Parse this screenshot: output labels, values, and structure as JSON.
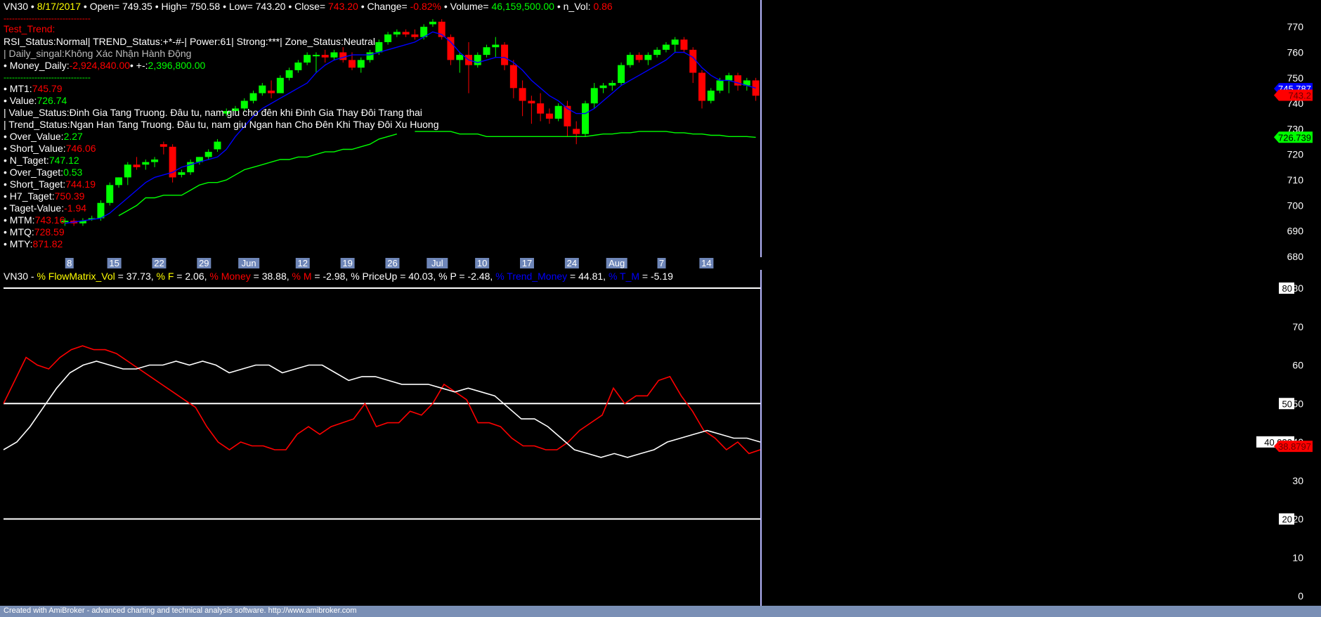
{
  "colors": {
    "bg": "#000000",
    "white": "#ffffff",
    "yellow": "#ffff00",
    "red": "#ff0000",
    "green": "#00ff00",
    "gray": "#bbbbbb",
    "blue": "#0000ff",
    "cursor": "#b8b8ff",
    "footer_bg": "#7a8fb5",
    "axis_badge": "#6e86b8"
  },
  "info": {
    "symbol": "VN30",
    "date": "8/17/2017",
    "open_label": "• Open=",
    "open": "749.35",
    "high_label": "• High=",
    "high": "750.58",
    "low_label": "• Low=",
    "low": "743.20",
    "close_label": "• Close=",
    "close": "743.20",
    "change_label": "• Change=",
    "change": "-0.82%",
    "volume_label": "• Volume=",
    "volume": "46,159,500.00",
    "nvol_label": "• n_Vol:",
    "nvol": "0.86",
    "dashes": "-------------------------------",
    "test_trend": "Test_Trend:",
    "status_line": "RSI_Status:Normal| TREND_Status:+*-#-| Power:61| Strong:***| Zone_Status:Neutral",
    "daily_signal": "| Daily_singal:Không Xác Nhận Hành Động",
    "money_label": "• Money_Daily:",
    "money_value": "-2,924,840.00",
    "money_sep": "• +-:",
    "money_plus": "2,396,800.00",
    "rows": [
      {
        "label": "• MT1:",
        "value": "745.79",
        "color": "#ff0000"
      },
      {
        "label": "• Value:",
        "value": "726.74",
        "color": "#00ff00"
      },
      {
        "label": "| Value_Status:Đinh Gia Tang Truong. Đâu tu, nam giu cho đên khi Đinh Gia Thay Đôi Trang thai",
        "value": "",
        "color": "#ffffff"
      },
      {
        "label": "| Trend_Status:Ngan Han Tang Truong. Đâu tu, nam giu Ngan han Cho Đên Khi Thay Đôi Xu Huong",
        "value": "",
        "color": "#ffffff"
      },
      {
        "label": "• Over_Value:",
        "value": "2.27",
        "color": "#00ff00"
      },
      {
        "label": "• Short_Value:",
        "value": "746.06",
        "color": "#ff0000"
      },
      {
        "label": "• N_Taget:",
        "value": "747.12",
        "color": "#00ff00"
      },
      {
        "label": "• Over_Taget:",
        "value": "0.53",
        "color": "#00ff00"
      },
      {
        "label": "• Short_Taget:",
        "value": "744.19",
        "color": "#ff0000"
      },
      {
        "label": "• H7_Taget:",
        "value": "750.39",
        "color": "#ff0000"
      },
      {
        "label": "• Taget-Value:",
        "value": "-1.94",
        "color": "#ff0000"
      },
      {
        "label": "• MTM:",
        "value": "743.16",
        "color": "#ff0000"
      },
      {
        "label": "• MTQ:",
        "value": "728.59",
        "color": "#ff0000"
      },
      {
        "label": "• MTY:",
        "value": "871.82",
        "color": "#ff0000"
      }
    ]
  },
  "date_axis": {
    "labels": [
      "8",
      "15",
      "22",
      "29",
      "Jun",
      "12",
      "19",
      "26",
      "Jul",
      "10",
      "17",
      "24",
      "Aug",
      "7",
      "14"
    ]
  },
  "price_axis": {
    "ticks": [
      "770",
      "760",
      "750",
      "740",
      "730",
      "720",
      "710",
      "700",
      "690",
      "680"
    ]
  },
  "price_badges": [
    {
      "text": "745.787",
      "value": 745.787,
      "fg": "#ffffff",
      "bg": "#0000ff"
    },
    {
      "text": "743.2",
      "value": 743.2,
      "fg": "#ff0000",
      "bg": "#ff0000"
    },
    {
      "text": "726.739",
      "value": 726.739,
      "fg": "#000000",
      "bg": "#00ff00"
    }
  ],
  "indicator": {
    "title_prefix": "VN30 - ",
    "parts": [
      {
        "text": "% FlowMatrix_Vol",
        "color": "#ffff00"
      },
      {
        "text": " = 37.73, ",
        "color": "#ffffff"
      },
      {
        "text": "% F",
        "color": "#ffff00"
      },
      {
        "text": " = 2.06, ",
        "color": "#ffffff"
      },
      {
        "text": "% Money",
        "color": "#ff0000"
      },
      {
        "text": " = 38.88, ",
        "color": "#ffffff"
      },
      {
        "text": "% M",
        "color": "#ff0000"
      },
      {
        "text": " = -2.98, ",
        "color": "#ffffff"
      },
      {
        "text": "% PriceUp",
        "color": "#ffffff"
      },
      {
        "text": " = 40.03, ",
        "color": "#ffffff"
      },
      {
        "text": "% P",
        "color": "#ffffff"
      },
      {
        "text": " = -2.48, ",
        "color": "#ffffff"
      },
      {
        "text": "% Trend_Money",
        "color": "#0000ff"
      },
      {
        "text": " = 44.81, ",
        "color": "#ffffff"
      },
      {
        "text": "% T_M",
        "color": "#0000ff"
      },
      {
        "text": " = -5.19",
        "color": "#ffffff"
      }
    ],
    "ticks": [
      "80",
      "70",
      "60",
      "50",
      "40",
      "30",
      "20",
      "10",
      "0"
    ],
    "badges": [
      {
        "text": "80",
        "value": 80,
        "fg": "#000000",
        "bg": "#ffffff"
      },
      {
        "text": "50",
        "value": 50,
        "fg": "#000000",
        "bg": "#ffffff"
      },
      {
        "text": "20",
        "value": 20,
        "fg": "#000000",
        "bg": "#ffffff"
      },
      {
        "text": "40.033",
        "value": 40.033,
        "fg": "#000000",
        "bg": "#ffffff"
      },
      {
        "text": "38.8797",
        "value": 38.8797,
        "fg": "#ff0000",
        "bg": "#ff0000"
      }
    ]
  },
  "footer": "Created with AmiBroker - advanced charting and technical analysis software. http://www.amibroker.com",
  "chart_data": [
    {
      "type": "candlestick",
      "title": "VN30",
      "ylim": [
        680,
        775
      ],
      "categories": [
        "8",
        "15",
        "22",
        "29",
        "Jun",
        "12",
        "19",
        "26",
        "Jul",
        "10",
        "17",
        "24",
        "Aug",
        "7",
        "14"
      ],
      "ohlc": [
        [
          694,
          695,
          692,
          694
        ],
        [
          694,
          695,
          692,
          693
        ],
        [
          693,
          695,
          692,
          694
        ],
        [
          695,
          696,
          694,
          695
        ],
        [
          695,
          702,
          694,
          701
        ],
        [
          701,
          709,
          700,
          708
        ],
        [
          708,
          711,
          707,
          711
        ],
        [
          711,
          717,
          708,
          716
        ],
        [
          716,
          719,
          714,
          715
        ],
        [
          716,
          718,
          714,
          717
        ],
        [
          717,
          719,
          715,
          718
        ],
        [
          724,
          725,
          720,
          723
        ],
        [
          723,
          724,
          709,
          711
        ],
        [
          712,
          714,
          711,
          713
        ],
        [
          713,
          718,
          712,
          717
        ],
        [
          717,
          719,
          716,
          719
        ],
        [
          719,
          722,
          718,
          721
        ],
        [
          722,
          726,
          721,
          725
        ],
        [
          736,
          738,
          735,
          737
        ],
        [
          737,
          739,
          736,
          738
        ],
        [
          738,
          742,
          737,
          741
        ],
        [
          741,
          745,
          740,
          744
        ],
        [
          744,
          748,
          743,
          747
        ],
        [
          745,
          749,
          742,
          744
        ],
        [
          744,
          751,
          744,
          750
        ],
        [
          750,
          754,
          749,
          753
        ],
        [
          753,
          757,
          752,
          756
        ],
        [
          756,
          760,
          755,
          759
        ],
        [
          759,
          760,
          752,
          759
        ],
        [
          759,
          761,
          756,
          758
        ],
        [
          758,
          761,
          757,
          760
        ],
        [
          760,
          762,
          756,
          757
        ],
        [
          757,
          760,
          753,
          754
        ],
        [
          754,
          758,
          752,
          757
        ],
        [
          757,
          761,
          756,
          760
        ],
        [
          760,
          765,
          759,
          764
        ],
        [
          764,
          768,
          763,
          767
        ],
        [
          767,
          769,
          766,
          768
        ],
        [
          768,
          769,
          766,
          767
        ],
        [
          767,
          769,
          765,
          766
        ],
        [
          766,
          771,
          765,
          770
        ],
        [
          771,
          773,
          770,
          772
        ],
        [
          772,
          773,
          765,
          766
        ],
        [
          766,
          767,
          755,
          757
        ],
        [
          757,
          760,
          752,
          759
        ],
        [
          759,
          764,
          744,
          755
        ],
        [
          755,
          760,
          754,
          759
        ],
        [
          759,
          763,
          758,
          762
        ],
        [
          762,
          766,
          758,
          763
        ],
        [
          763,
          764,
          753,
          755
        ],
        [
          755,
          757,
          742,
          746
        ],
        [
          746,
          749,
          735,
          741
        ],
        [
          741,
          743,
          732,
          740
        ],
        [
          740,
          744,
          733,
          736
        ],
        [
          736,
          738,
          732,
          734
        ],
        [
          734,
          740,
          733,
          739
        ],
        [
          739,
          741,
          727,
          731
        ],
        [
          730,
          733,
          724,
          728
        ],
        [
          728,
          741,
          727,
          740
        ],
        [
          740,
          748,
          738,
          746
        ],
        [
          746,
          748,
          744,
          747
        ],
        [
          747,
          749,
          745,
          748
        ],
        [
          748,
          756,
          747,
          755
        ],
        [
          755,
          760,
          754,
          759
        ],
        [
          759,
          760,
          756,
          757
        ],
        [
          757,
          760,
          755,
          759
        ],
        [
          759,
          762,
          758,
          761
        ],
        [
          761,
          764,
          760,
          763
        ],
        [
          763,
          766,
          760,
          765
        ],
        [
          765,
          766,
          760,
          761
        ],
        [
          761,
          762,
          748,
          752
        ],
        [
          752,
          753,
          738,
          741
        ],
        [
          741,
          746,
          740,
          745
        ],
        [
          745,
          750,
          744,
          749
        ],
        [
          749,
          752,
          744,
          751
        ],
        [
          751,
          752,
          745,
          747
        ],
        [
          747,
          750,
          745,
          749
        ],
        [
          749,
          750,
          741,
          743
        ]
      ],
      "series": [
        {
          "name": "MT1",
          "color": "#0000ff",
          "values": [
            693,
            693.5,
            694,
            694.5,
            695,
            697,
            700,
            703,
            706,
            709,
            711,
            712,
            713,
            715,
            716,
            717,
            718,
            719,
            722,
            727,
            731,
            735,
            738,
            740,
            742,
            744,
            746,
            748,
            752,
            755,
            757,
            758,
            759,
            759,
            759,
            760,
            761,
            762,
            763,
            764,
            766,
            768,
            767,
            764,
            760,
            757,
            756,
            757,
            758,
            758,
            756,
            753,
            749,
            746,
            743,
            741,
            738,
            736,
            736,
            738,
            741,
            744,
            747,
            749,
            751,
            753,
            755,
            757,
            760,
            760,
            758,
            754,
            751,
            749,
            749,
            748,
            747,
            746
          ]
        },
        {
          "name": "Value",
          "color": "#00ff00",
          "values": [
            null,
            null,
            null,
            null,
            null,
            null,
            696,
            698,
            700,
            703,
            703,
            704,
            704,
            704,
            706,
            708,
            709,
            709,
            710,
            712,
            714,
            715,
            716,
            717,
            718,
            718,
            719,
            719,
            720,
            721,
            721,
            722,
            722,
            723,
            724,
            726,
            727,
            728,
            null,
            729,
            729,
            729,
            729,
            729,
            728,
            728,
            728,
            727,
            727,
            727,
            727,
            727,
            727,
            727,
            727,
            727,
            727,
            727,
            727,
            727.5,
            728,
            728,
            728.5,
            728.5,
            729,
            729,
            729,
            729,
            728.5,
            728.5,
            728,
            728,
            727.5,
            727.5,
            727,
            727,
            727,
            726.7
          ]
        }
      ]
    },
    {
      "type": "line",
      "title": "VN30 - % FlowMatrix_Vol",
      "ylim": [
        0,
        80
      ],
      "reference_lines": [
        80,
        50,
        20
      ],
      "series": [
        {
          "name": "% Money",
          "color": "#ff0000",
          "values": [
            50,
            56,
            62,
            60,
            59,
            62,
            64,
            65,
            64,
            64,
            63,
            61,
            59,
            57,
            55,
            53,
            51,
            49,
            44,
            40,
            38,
            40,
            39,
            39,
            38,
            38,
            42,
            44,
            42,
            44,
            45,
            46,
            50,
            44,
            45,
            45,
            48,
            47,
            50,
            55,
            53,
            51,
            45,
            45,
            44,
            41,
            39,
            39,
            38,
            38,
            40,
            43,
            45,
            47,
            54,
            50,
            52,
            52,
            56,
            57,
            52,
            48,
            43,
            41,
            38,
            40,
            37,
            38
          ]
        },
        {
          "name": "% PriceUp",
          "color": "#ffffff",
          "values": [
            38,
            40,
            44,
            49,
            54,
            58,
            60,
            61,
            60,
            59,
            59,
            60,
            60,
            61,
            60,
            61,
            60,
            58,
            59,
            60,
            60,
            58,
            59,
            60,
            60,
            58,
            56,
            57,
            57,
            56,
            55,
            55,
            55,
            54,
            53,
            54,
            53,
            52,
            49,
            46,
            46,
            44,
            41,
            38,
            37,
            36,
            37,
            36,
            37,
            38,
            40,
            41,
            42,
            43,
            42,
            41,
            41,
            40
          ]
        }
      ]
    }
  ]
}
